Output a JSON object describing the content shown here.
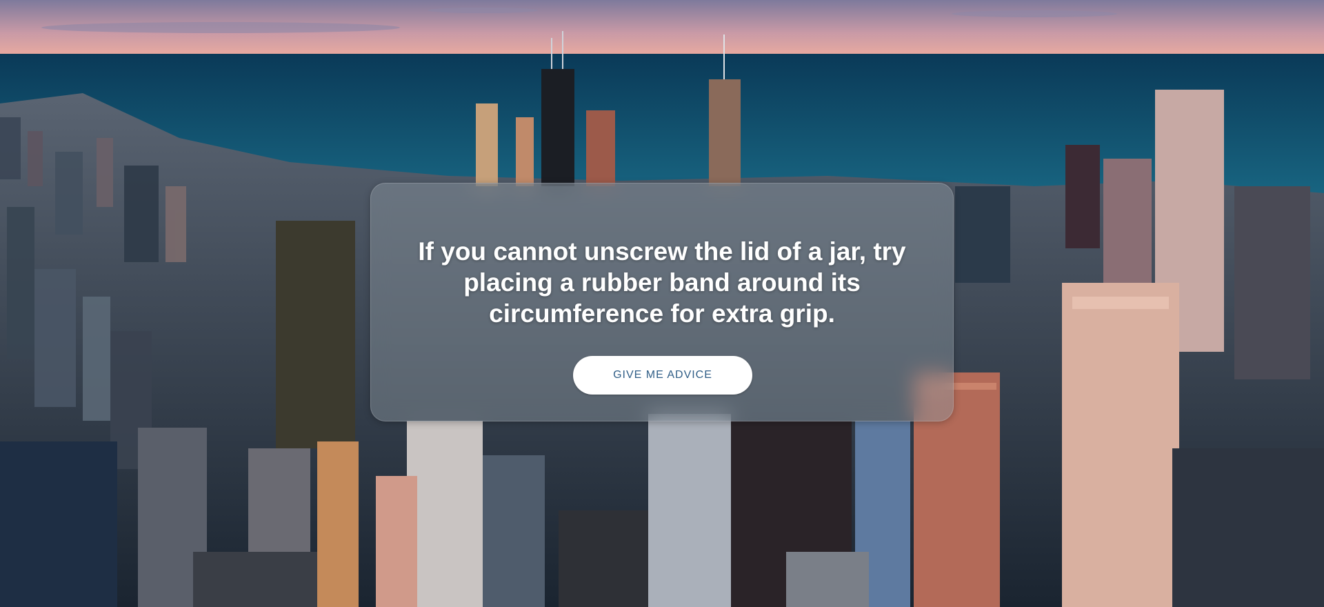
{
  "advice": {
    "text": "If you cannot unscrew the lid of a jar, try placing a rubber band around its circumference for extra grip."
  },
  "button": {
    "label": "GIVE ME ADVICE"
  },
  "background": {
    "subject": "aerial-city-skyline",
    "colors": {
      "sky_top": "#8a7fa0",
      "sky_horizon": "#e7a6a0",
      "water": "#0d4a6b",
      "water_far": "#0b3d5c",
      "city_dark": "#1c2a38",
      "city_warm": "#b06e5a",
      "button_text": "#2f5d86"
    }
  }
}
